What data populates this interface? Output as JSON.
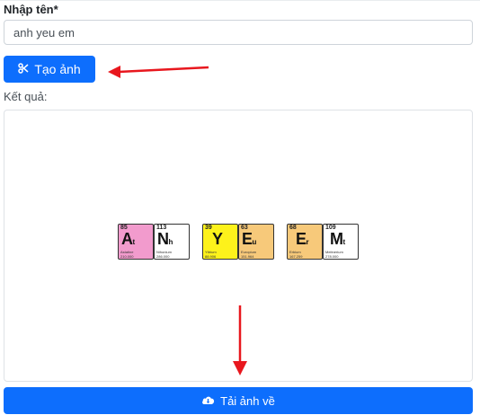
{
  "form": {
    "name_label": "Nhập tên*",
    "name_value": "anh yeu em",
    "create_button": "Tạo ảnh",
    "result_label": "Kết quả:",
    "download_button": "Tải ảnh về"
  },
  "colors": {
    "primary": "#0d6efd",
    "arrow": "#e8171e",
    "pink": "#f29bcd",
    "yellow": "#fdf21b",
    "orange": "#f7c97a",
    "white": "#ffffff"
  },
  "icons": {
    "create": "scissors-icon",
    "download": "cloud-download-icon"
  },
  "tiles": [
    {
      "number": "85",
      "symbol": "A",
      "sub": "t",
      "name": "Astatine",
      "mass": "210.000"
    },
    {
      "number": "113",
      "symbol": "N",
      "sub": "h",
      "name": "Nihonium",
      "mass": "286.000"
    },
    {
      "number": "39",
      "symbol": "Y",
      "sub": "",
      "name": "Yttrium",
      "mass": "88.906"
    },
    {
      "number": "63",
      "symbol": "E",
      "sub": "u",
      "name": "Europium",
      "mass": "151.964"
    },
    {
      "number": "68",
      "symbol": "E",
      "sub": "r",
      "name": "Erbium",
      "mass": "167.259"
    },
    {
      "number": "109",
      "symbol": "M",
      "sub": "t",
      "name": "Meitnerium",
      "mass": "278.000"
    }
  ]
}
